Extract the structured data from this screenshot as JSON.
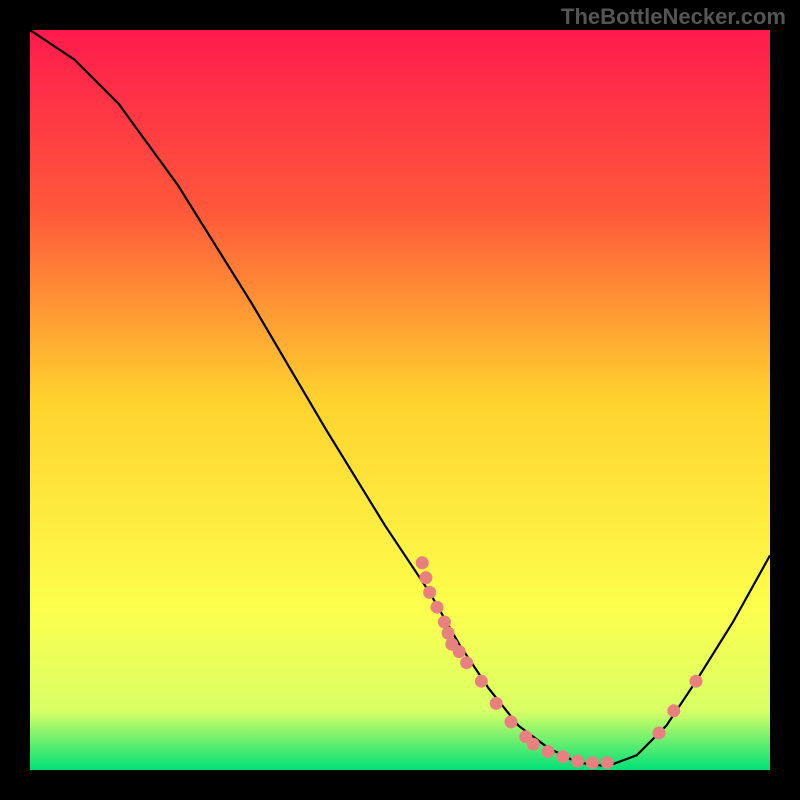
{
  "watermark": "TheBottleNecker.com",
  "chart_data": {
    "type": "line",
    "title": "",
    "xlabel": "",
    "ylabel": "",
    "xlim": [
      0,
      100
    ],
    "ylim": [
      0,
      100
    ],
    "gradient_stops": [
      {
        "offset": 0,
        "color": "#ff1a4d"
      },
      {
        "offset": 25,
        "color": "#ff5a3a"
      },
      {
        "offset": 50,
        "color": "#ffd22e"
      },
      {
        "offset": 78,
        "color": "#fdff4d"
      },
      {
        "offset": 92,
        "color": "#d9ff66"
      },
      {
        "offset": 100,
        "color": "#00e077"
      }
    ],
    "curve": [
      {
        "x": 0,
        "y": 100
      },
      {
        "x": 6,
        "y": 96
      },
      {
        "x": 12,
        "y": 90
      },
      {
        "x": 20,
        "y": 79
      },
      {
        "x": 30,
        "y": 63
      },
      {
        "x": 40,
        "y": 46
      },
      {
        "x": 48,
        "y": 33
      },
      {
        "x": 54,
        "y": 24
      },
      {
        "x": 58,
        "y": 17
      },
      {
        "x": 62,
        "y": 11
      },
      {
        "x": 66,
        "y": 6
      },
      {
        "x": 70,
        "y": 3
      },
      {
        "x": 74,
        "y": 1
      },
      {
        "x": 78,
        "y": 0.5
      },
      {
        "x": 82,
        "y": 2
      },
      {
        "x": 86,
        "y": 6
      },
      {
        "x": 90,
        "y": 12
      },
      {
        "x": 95,
        "y": 20
      },
      {
        "x": 100,
        "y": 29
      }
    ],
    "scatter": [
      {
        "x": 53,
        "y": 28
      },
      {
        "x": 53.5,
        "y": 26
      },
      {
        "x": 54,
        "y": 24
      },
      {
        "x": 55,
        "y": 22
      },
      {
        "x": 56,
        "y": 20
      },
      {
        "x": 56.5,
        "y": 18.5
      },
      {
        "x": 57,
        "y": 17
      },
      {
        "x": 58,
        "y": 16
      },
      {
        "x": 59,
        "y": 14.5
      },
      {
        "x": 61,
        "y": 12
      },
      {
        "x": 63,
        "y": 9
      },
      {
        "x": 65,
        "y": 6.5
      },
      {
        "x": 67,
        "y": 4.5
      },
      {
        "x": 68,
        "y": 3.5
      },
      {
        "x": 70,
        "y": 2.5
      },
      {
        "x": 72,
        "y": 1.8
      },
      {
        "x": 74,
        "y": 1.2
      },
      {
        "x": 76,
        "y": 1
      },
      {
        "x": 78,
        "y": 1
      },
      {
        "x": 85,
        "y": 5
      },
      {
        "x": 87,
        "y": 8
      },
      {
        "x": 90,
        "y": 12
      }
    ],
    "scatter_color": "#e98080",
    "curve_color": "#000000"
  }
}
